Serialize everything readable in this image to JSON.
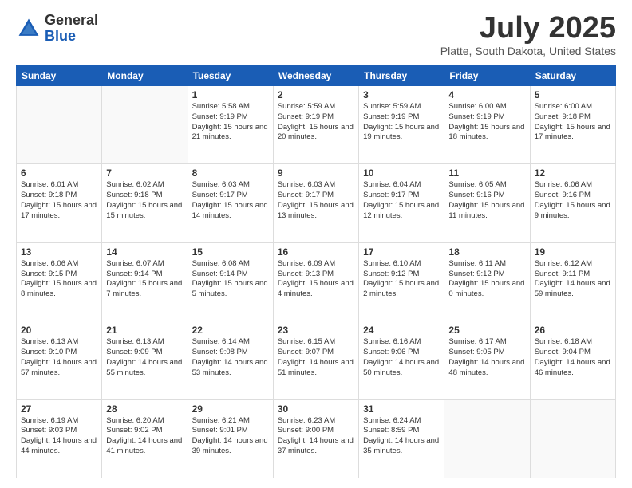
{
  "header": {
    "logo_general": "General",
    "logo_blue": "Blue",
    "month_title": "July 2025",
    "location": "Platte, South Dakota, United States"
  },
  "days_of_week": [
    "Sunday",
    "Monday",
    "Tuesday",
    "Wednesday",
    "Thursday",
    "Friday",
    "Saturday"
  ],
  "weeks": [
    [
      {
        "day": "",
        "info": ""
      },
      {
        "day": "",
        "info": ""
      },
      {
        "day": "1",
        "info": "Sunrise: 5:58 AM\nSunset: 9:19 PM\nDaylight: 15 hours and 21 minutes."
      },
      {
        "day": "2",
        "info": "Sunrise: 5:59 AM\nSunset: 9:19 PM\nDaylight: 15 hours and 20 minutes."
      },
      {
        "day": "3",
        "info": "Sunrise: 5:59 AM\nSunset: 9:19 PM\nDaylight: 15 hours and 19 minutes."
      },
      {
        "day": "4",
        "info": "Sunrise: 6:00 AM\nSunset: 9:19 PM\nDaylight: 15 hours and 18 minutes."
      },
      {
        "day": "5",
        "info": "Sunrise: 6:00 AM\nSunset: 9:18 PM\nDaylight: 15 hours and 17 minutes."
      }
    ],
    [
      {
        "day": "6",
        "info": "Sunrise: 6:01 AM\nSunset: 9:18 PM\nDaylight: 15 hours and 17 minutes."
      },
      {
        "day": "7",
        "info": "Sunrise: 6:02 AM\nSunset: 9:18 PM\nDaylight: 15 hours and 15 minutes."
      },
      {
        "day": "8",
        "info": "Sunrise: 6:03 AM\nSunset: 9:17 PM\nDaylight: 15 hours and 14 minutes."
      },
      {
        "day": "9",
        "info": "Sunrise: 6:03 AM\nSunset: 9:17 PM\nDaylight: 15 hours and 13 minutes."
      },
      {
        "day": "10",
        "info": "Sunrise: 6:04 AM\nSunset: 9:17 PM\nDaylight: 15 hours and 12 minutes."
      },
      {
        "day": "11",
        "info": "Sunrise: 6:05 AM\nSunset: 9:16 PM\nDaylight: 15 hours and 11 minutes."
      },
      {
        "day": "12",
        "info": "Sunrise: 6:06 AM\nSunset: 9:16 PM\nDaylight: 15 hours and 9 minutes."
      }
    ],
    [
      {
        "day": "13",
        "info": "Sunrise: 6:06 AM\nSunset: 9:15 PM\nDaylight: 15 hours and 8 minutes."
      },
      {
        "day": "14",
        "info": "Sunrise: 6:07 AM\nSunset: 9:14 PM\nDaylight: 15 hours and 7 minutes."
      },
      {
        "day": "15",
        "info": "Sunrise: 6:08 AM\nSunset: 9:14 PM\nDaylight: 15 hours and 5 minutes."
      },
      {
        "day": "16",
        "info": "Sunrise: 6:09 AM\nSunset: 9:13 PM\nDaylight: 15 hours and 4 minutes."
      },
      {
        "day": "17",
        "info": "Sunrise: 6:10 AM\nSunset: 9:12 PM\nDaylight: 15 hours and 2 minutes."
      },
      {
        "day": "18",
        "info": "Sunrise: 6:11 AM\nSunset: 9:12 PM\nDaylight: 15 hours and 0 minutes."
      },
      {
        "day": "19",
        "info": "Sunrise: 6:12 AM\nSunset: 9:11 PM\nDaylight: 14 hours and 59 minutes."
      }
    ],
    [
      {
        "day": "20",
        "info": "Sunrise: 6:13 AM\nSunset: 9:10 PM\nDaylight: 14 hours and 57 minutes."
      },
      {
        "day": "21",
        "info": "Sunrise: 6:13 AM\nSunset: 9:09 PM\nDaylight: 14 hours and 55 minutes."
      },
      {
        "day": "22",
        "info": "Sunrise: 6:14 AM\nSunset: 9:08 PM\nDaylight: 14 hours and 53 minutes."
      },
      {
        "day": "23",
        "info": "Sunrise: 6:15 AM\nSunset: 9:07 PM\nDaylight: 14 hours and 51 minutes."
      },
      {
        "day": "24",
        "info": "Sunrise: 6:16 AM\nSunset: 9:06 PM\nDaylight: 14 hours and 50 minutes."
      },
      {
        "day": "25",
        "info": "Sunrise: 6:17 AM\nSunset: 9:05 PM\nDaylight: 14 hours and 48 minutes."
      },
      {
        "day": "26",
        "info": "Sunrise: 6:18 AM\nSunset: 9:04 PM\nDaylight: 14 hours and 46 minutes."
      }
    ],
    [
      {
        "day": "27",
        "info": "Sunrise: 6:19 AM\nSunset: 9:03 PM\nDaylight: 14 hours and 44 minutes."
      },
      {
        "day": "28",
        "info": "Sunrise: 6:20 AM\nSunset: 9:02 PM\nDaylight: 14 hours and 41 minutes."
      },
      {
        "day": "29",
        "info": "Sunrise: 6:21 AM\nSunset: 9:01 PM\nDaylight: 14 hours and 39 minutes."
      },
      {
        "day": "30",
        "info": "Sunrise: 6:23 AM\nSunset: 9:00 PM\nDaylight: 14 hours and 37 minutes."
      },
      {
        "day": "31",
        "info": "Sunrise: 6:24 AM\nSunset: 8:59 PM\nDaylight: 14 hours and 35 minutes."
      },
      {
        "day": "",
        "info": ""
      },
      {
        "day": "",
        "info": ""
      }
    ]
  ]
}
